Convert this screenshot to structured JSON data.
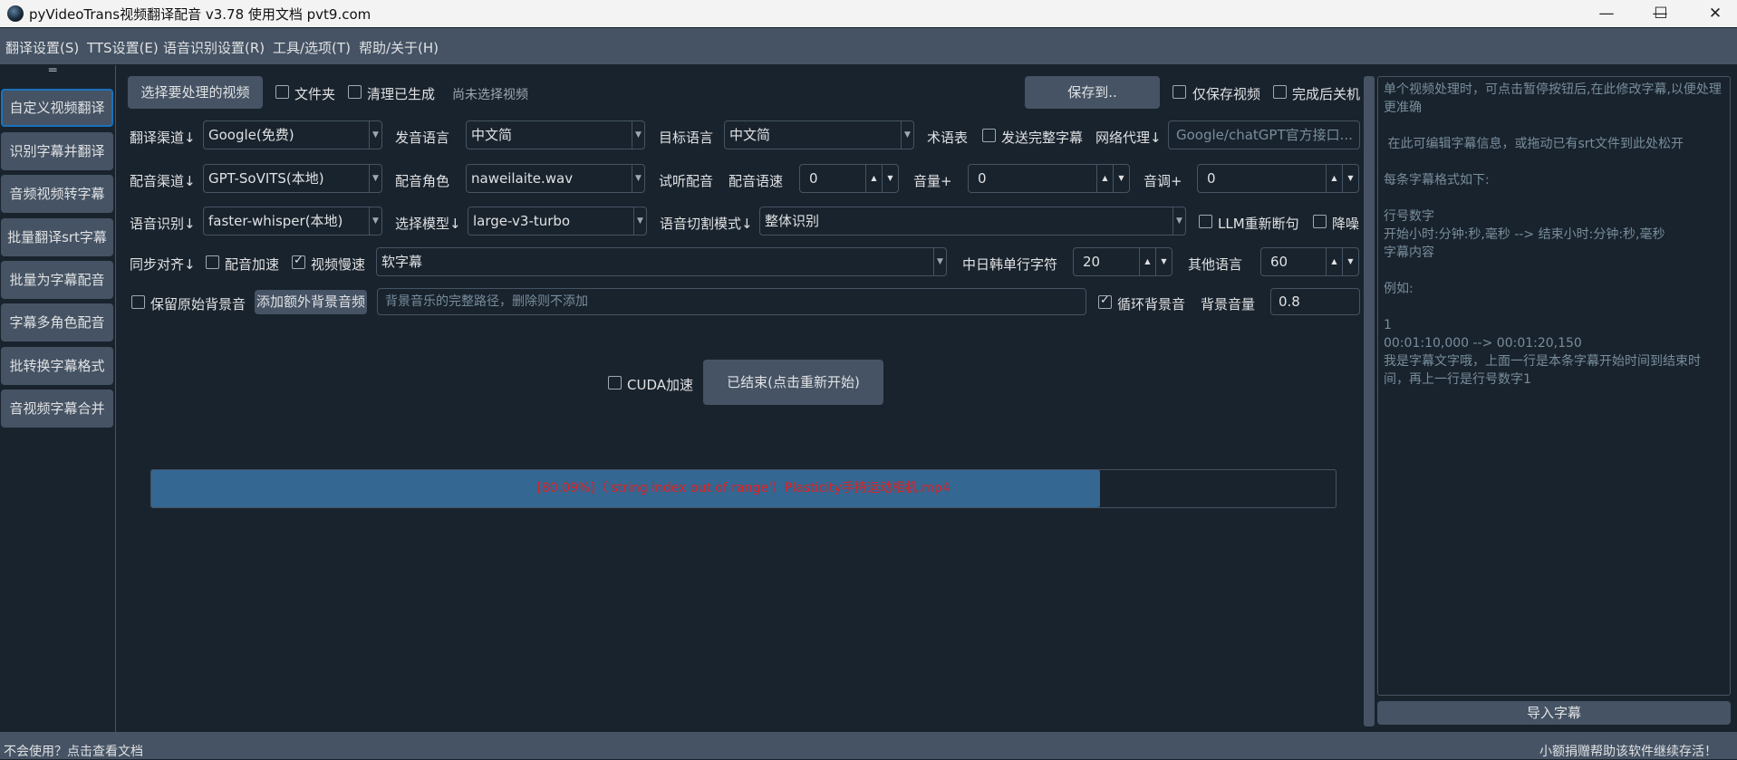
{
  "window": {
    "title": "pyVideoTrans视频翻译配音 v3.78  使用文档  pvt9.com",
    "minimize": "—",
    "maximize": "☐",
    "close": "✕"
  },
  "menu": [
    "翻译设置(S)",
    "TTS设置(E)",
    "语音识别设置(R)",
    "工具/选项(T)",
    "帮助/关于(H)"
  ],
  "sidebar": {
    "handle": "═",
    "items": [
      "自定义视频翻译",
      "识别字幕并翻译",
      "音频视频转字幕",
      "批量翻译srt字幕",
      "批量为字幕配音",
      "字幕多角色配音",
      "批转换字幕格式",
      "音视频字幕合并"
    ]
  },
  "row1": {
    "select_video_button": "选择要处理的视频",
    "folder_label": "文件夹",
    "clear_label": "清理已生成",
    "status": "尚未选择视频",
    "save_to_button": "保存到..",
    "only_save_video_label": "仅保存视频",
    "shutdown_label": "完成后关机"
  },
  "row2": {
    "translate_channel_label": "翻译渠道↓",
    "translate_channel_value": "Google(免费)",
    "source_lang_label": "发音语言",
    "source_lang_value": "中文简",
    "target_lang_label": "目标语言",
    "target_lang_value": "中文简",
    "glossary_label": "术语表",
    "send_full_label": "发送完整字幕",
    "proxy_label": "网络代理↓",
    "proxy_placeholder": "Google/chatGPT官方接口..."
  },
  "row3": {
    "dub_channel_label": "配音渠道↓",
    "dub_channel_value": "GPT-SoVITS(本地)",
    "role_label": "配音角色",
    "role_value": "naweilaite.wav",
    "listen_label": "试听配音",
    "speed_label": "配音语速",
    "speed_value": "0",
    "volume_label": "音量+",
    "volume_value": "0",
    "pitch_label": "音调+",
    "pitch_value": "0"
  },
  "row4": {
    "asr_label": "语音识别↓",
    "asr_value": "faster-whisper(本地)",
    "model_label": "选择模型↓",
    "model_value": "large-v3-turbo",
    "split_label": "语音切割模式↓",
    "split_value": "整体识别",
    "llm_label": "LLM重新断句",
    "denoise_label": "降噪"
  },
  "row5": {
    "align_label": "同步对齐↓",
    "dub_speedup_label": "配音加速",
    "dub_speedup_checked": false,
    "video_slow_label": "视频慢速",
    "video_slow_checked": true,
    "subtitle_value": "软字幕",
    "cjk_chars_label": "中日韩单行字符",
    "cjk_chars_value": "20",
    "other_lang_label": "其他语言",
    "other_lang_value": "60"
  },
  "row6": {
    "keep_bg_label": "保留原始背景音",
    "add_bg_button": "添加额外背景音频",
    "bg_path_placeholder": "背景音乐的完整路径，删除则不添加",
    "loop_bg_label": "循环背景音",
    "loop_bg_checked": true,
    "bg_volume_label": "背景音量",
    "bg_volume_value": "0.8"
  },
  "action": {
    "cuda_label": "CUDA加速",
    "start_button": "已结束(点击重新开始)"
  },
  "progress": {
    "percent": 80.09,
    "text": "[80.09%]（'string index out of range'）Plasticity手持运动相机.mp4",
    "text_color": "#e02020",
    "fill_color": "#346792"
  },
  "right_panel": {
    "lines": [
      "单个视频处理时，可点击暂停按钮后,在此修改字幕,以便处理更准确",
      "",
      " 在此可编辑字幕信息，或拖动已有srt文件到此处松开",
      "",
      "每条字幕格式如下:",
      "",
      "行号数字",
      "开始小时:分钟:秒,毫秒 --> 结束小时:分钟:秒,毫秒",
      "字幕内容",
      "",
      "例如:",
      "",
      "1",
      "00:01:10,000 --> 00:01:20,150",
      "我是字幕文字哦，上面一行是本条字幕开始时间到结束时间，再上一行是行号数字1"
    ],
    "import_button": "导入字幕"
  },
  "statusbar": {
    "left": "不会使用？点击查看文档",
    "right": "小额捐赠帮助该软件继续存活！"
  }
}
